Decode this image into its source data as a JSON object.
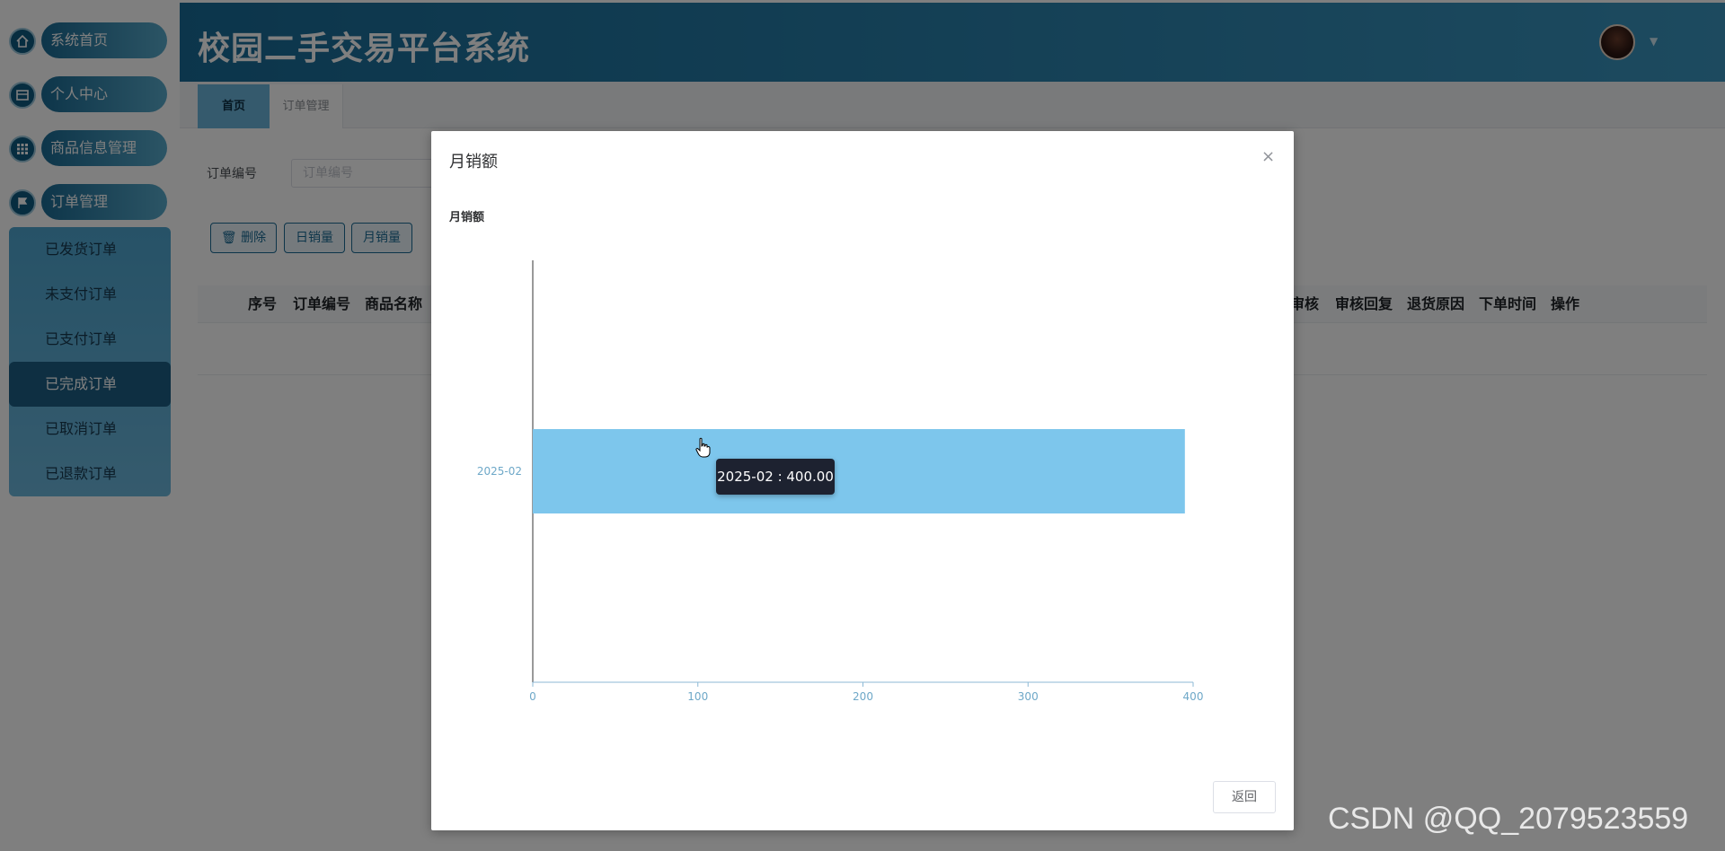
{
  "app": {
    "title": "校园二手交易平台系统"
  },
  "sidebar": {
    "items": [
      {
        "label": "系统首页",
        "icon": "home-icon"
      },
      {
        "label": "个人中心",
        "icon": "profile-icon"
      },
      {
        "label": "商品信息管理",
        "icon": "grid-icon"
      },
      {
        "label": "订单管理",
        "icon": "flag-icon"
      }
    ],
    "submenu": [
      {
        "label": "已发货订单",
        "active": false
      },
      {
        "label": "未支付订单",
        "active": false
      },
      {
        "label": "已支付订单",
        "active": false
      },
      {
        "label": "已完成订单",
        "active": true
      },
      {
        "label": "已取消订单",
        "active": false
      },
      {
        "label": "已退款订单",
        "active": false
      }
    ]
  },
  "tabs": [
    {
      "label": "首页",
      "active": true
    },
    {
      "label": "订单管理",
      "active": false
    }
  ],
  "search": {
    "label": "订单编号",
    "placeholder": "订单编号"
  },
  "toolbar": {
    "delete_label": "删除",
    "daily_label": "日销量",
    "monthly_label": "月销量"
  },
  "table": {
    "columns_left": [
      "序号",
      "订单编号",
      "商品名称"
    ],
    "columns_right": [
      "审核",
      "审核回复",
      "退货原因",
      "下单时间",
      "操作"
    ]
  },
  "dialog": {
    "title": "月销额",
    "close_label": "×",
    "return_label": "返回"
  },
  "chart_data": {
    "type": "bar",
    "orientation": "horizontal",
    "title": "月销额",
    "categories": [
      "2025-02"
    ],
    "values": [
      395
    ],
    "xlim": [
      0,
      400
    ],
    "x_ticks": [
      0,
      100,
      200,
      300,
      400
    ],
    "bar_color": "#7dc6ec",
    "tooltip": "2025-02 : 400.00",
    "grid": false,
    "legend": "none"
  },
  "watermark": "CSDN @QQ_2079523559",
  "colors": {
    "accent": "#1b6b94",
    "header": "#186b97",
    "active_tab": "#6bb5db",
    "bar": "#7dc6ec"
  }
}
